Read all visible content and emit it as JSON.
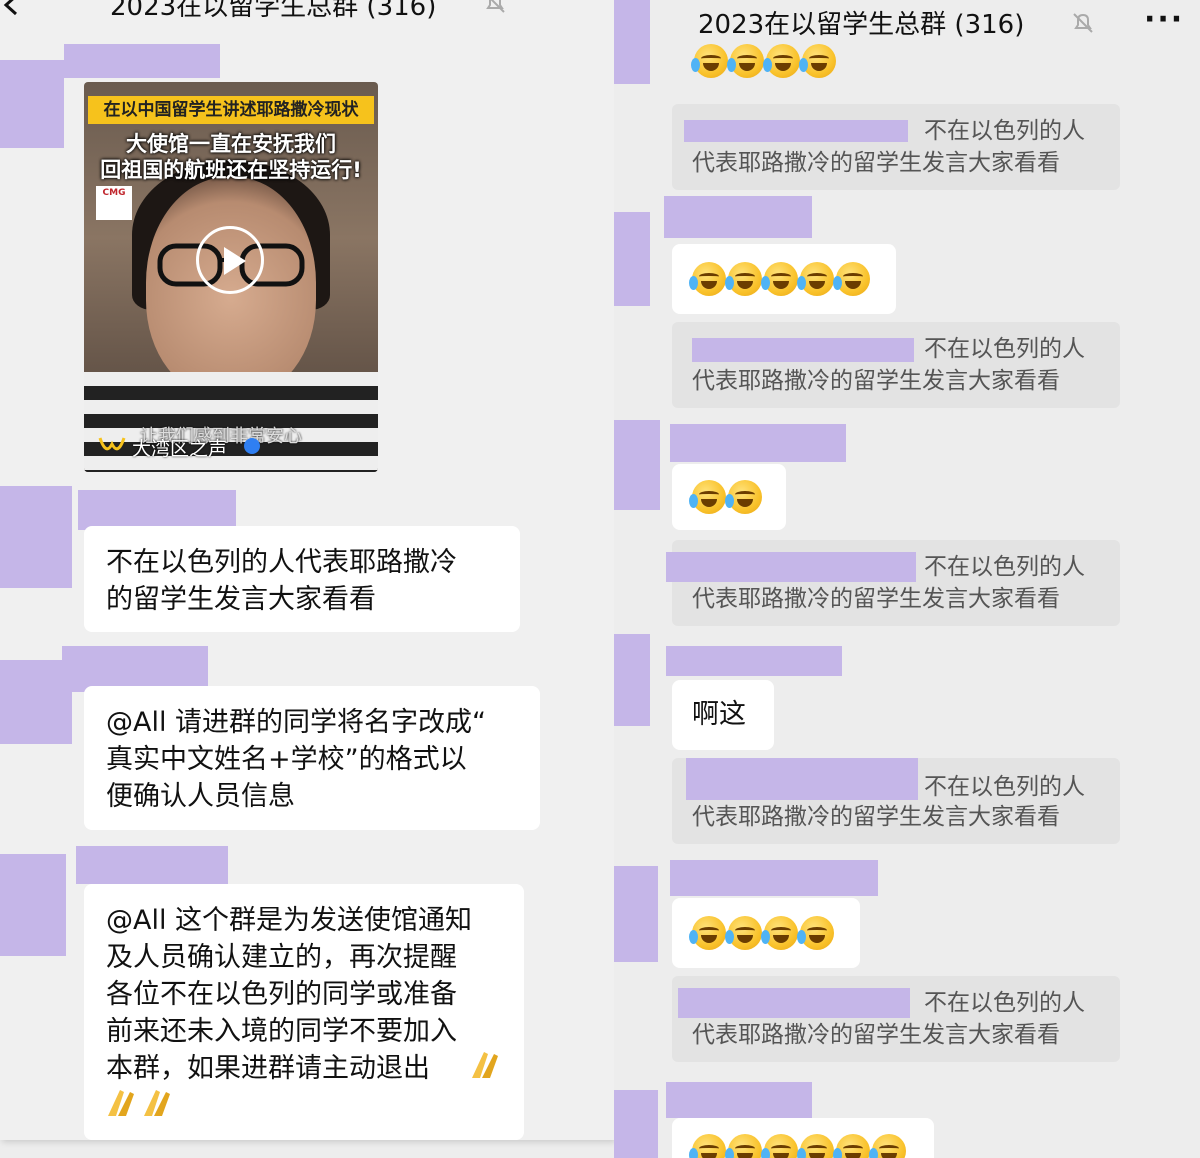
{
  "left": {
    "title": "2023在以留学生总群 (316)",
    "more": "···",
    "video": {
      "banner": "在以中国留学生讲述耶路撒冷现状",
      "caption_line1": "大使馆一直在安抚我们",
      "caption_line2": "回祖国的航班还在坚持运行!",
      "logo": "CMG",
      "subtitle": "让我们感到非常安心",
      "source": "大湾区之声"
    },
    "messages": [
      {
        "text": "不在以色列的人代表耶路撒冷\n的留学生发言大家看看"
      },
      {
        "text": "@All 请进群的同学将名字改成“\n真实中文姓名+学校”的格式以\n便确认人员信息"
      },
      {
        "text": "@All 这个群是为发送使馆通知\n及人员确认建立的，再次提醒\n各位不在以色列的同学或准备\n前来还未入境的同学不要加入\n本群，如果进群请主动退出"
      }
    ]
  },
  "right": {
    "title": "2023在以留学生总群 (316)",
    "more": "···",
    "quote_line1": "不在以色列的人",
    "quote_line2": "代表耶路撒冷的留学生发言大家看看",
    "reply_text": "啊这"
  },
  "colors": {
    "redaction": "#c5b6e8",
    "bubble": "#ffffff",
    "background": "#ededed",
    "quote_bg": "#e3e3e3"
  }
}
